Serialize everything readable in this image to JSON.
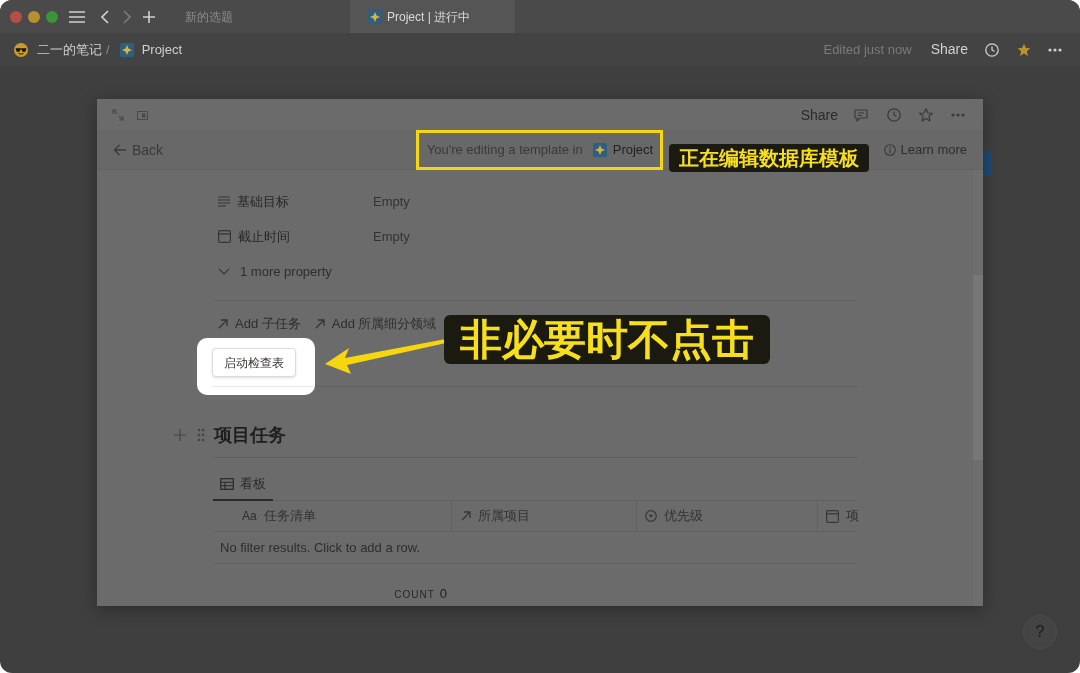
{
  "tabs": [
    {
      "label": "新的选题",
      "selected": false
    },
    {
      "label": "Project | 进行中",
      "selected": true,
      "page_icon": true
    }
  ],
  "breadcrumb": {
    "items": [
      "二一的笔记",
      "Project"
    ],
    "separator": "/"
  },
  "topbar": {
    "edited": "Edited just now",
    "share": "Share",
    "favorite": true
  },
  "modal": {
    "share": "Share",
    "favorite": false,
    "template_banner": {
      "back": "Back",
      "text": "You're editing a template in",
      "database": "Project",
      "learn_more": "Learn more"
    },
    "properties": [
      {
        "kind": "text",
        "name": "基础目标",
        "value": "Empty"
      },
      {
        "kind": "date",
        "name": "截止时间",
        "value": "Empty"
      }
    ],
    "more_properties": "1 more property",
    "relations": [
      "Add 子任务",
      "Add 所属细分领域"
    ],
    "button": "启动检查表",
    "section": {
      "title": "项目任务",
      "views": [
        {
          "label": "看板",
          "selected": true
        }
      ],
      "columns": [
        {
          "kind": "title",
          "type_label": "Aa",
          "label": "任务清单"
        },
        {
          "kind": "relation",
          "label": "所属项目"
        },
        {
          "kind": "select",
          "label": "优先级"
        },
        {
          "kind": "date",
          "label": "项"
        }
      ],
      "empty_message": "No filter results. Click to add a row.",
      "count": {
        "label": "COUNT",
        "value": "0"
      }
    }
  },
  "annotations": [
    {
      "text": "正在编辑数据库模板"
    },
    {
      "text": "非必要时不点击"
    }
  ],
  "help": "?"
}
